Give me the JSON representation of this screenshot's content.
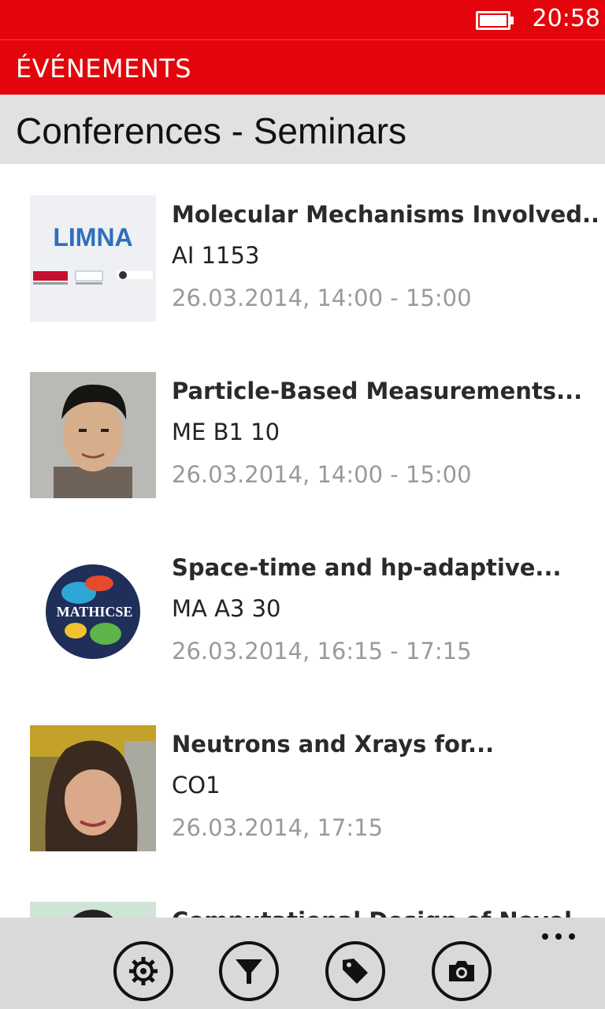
{
  "status": {
    "time": "20:58"
  },
  "app": {
    "title": "ÉVÉNEMENTS"
  },
  "page": {
    "title": "Conferences - Seminars"
  },
  "events": [
    {
      "title": "Molecular Mechanisms Involved...",
      "room": "AI 1153",
      "date": "26.03.2014, 14:00 - 15:00",
      "thumb_text": "LIMNA"
    },
    {
      "title": "Particle-Based Measurements...",
      "room": "ME B1 10",
      "date": "26.03.2014, 14:00 - 15:00"
    },
    {
      "title": "Space-time and hp-adaptive...",
      "room": "MA A3 30",
      "date": "26.03.2014, 16:15 - 17:15",
      "thumb_text": "MATHICSE"
    },
    {
      "title": "Neutrons and Xrays for...",
      "room": "CO1",
      "date": "26.03.2014, 17:15"
    },
    {
      "title": "Computational Design of Novel..."
    }
  ],
  "appbar_buttons": [
    "settings-icon",
    "filter-icon",
    "tag-icon",
    "camera-icon"
  ],
  "colors": {
    "accent": "#e3050b",
    "header_bg": "#e1e1e1",
    "appbar_bg": "#d9d9d9",
    "date_gray": "#9a9a9a"
  }
}
